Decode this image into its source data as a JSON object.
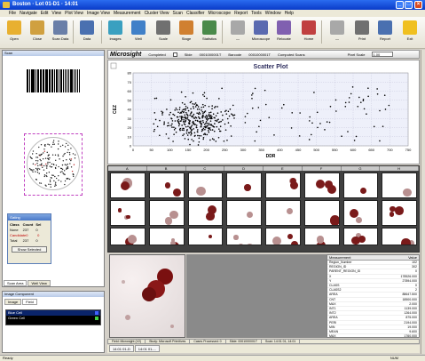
{
  "window": {
    "title": "Boston · Lot 01-D1 · 14:01"
  },
  "menu": [
    "File",
    "Navigate",
    "Edit",
    "View",
    "Plot View",
    "Image View",
    "Measurement",
    "Cluster View",
    "Scan",
    "Classifier",
    "Microscope",
    "Report",
    "Tools",
    "Window",
    "Help"
  ],
  "toolbar": [
    {
      "label": "Open",
      "icon": "folder-open-icon",
      "color": "#e8b030"
    },
    {
      "label": "Close",
      "icon": "folder-close-icon",
      "color": "#d0a040"
    },
    {
      "label": "Scan Data",
      "icon": "scan-data-icon",
      "color": "#6a7fa8"
    },
    {
      "label": "Data",
      "icon": "data-table-icon",
      "color": "#4a70b0"
    },
    {
      "label": "Images",
      "icon": "images-icon",
      "color": "#3aa0c0"
    },
    {
      "label": "Well",
      "icon": "well-icon",
      "color": "#4080c8"
    },
    {
      "label": "Scale",
      "icon": "scale-icon",
      "color": "#707070"
    },
    {
      "label": "Stage",
      "icon": "stage-icon",
      "color": "#d08030"
    },
    {
      "label": "Statistics",
      "icon": "statistics-icon",
      "color": "#4a8a4a"
    },
    {
      "label": "—",
      "icon": "disabled-icon",
      "color": "#a8a8a8"
    },
    {
      "label": "Microscope",
      "icon": "microscope-icon",
      "color": "#5a6ab0"
    },
    {
      "label": "Relocate",
      "icon": "relocate-icon",
      "color": "#8060b0"
    },
    {
      "label": "Home",
      "icon": "home-icon",
      "color": "#c04040"
    },
    {
      "label": "—",
      "icon": "disabled-icon-2",
      "color": "#a8a8a8"
    },
    {
      "label": "Print",
      "icon": "print-icon",
      "color": "#707070"
    },
    {
      "label": "Report",
      "icon": "report-icon",
      "color": "#4a70b0"
    },
    {
      "label": "Exit",
      "icon": "exit-icon",
      "color": "#f0c020"
    }
  ],
  "left_panel": {
    "head": "Scan",
    "tabs": [
      "Scan Area",
      "Well View"
    ],
    "dialog": {
      "caption": "Gating",
      "headers": [
        "Class",
        "Count",
        "Sel"
      ],
      "rows": [
        [
          "None",
          "237",
          "0"
        ],
        [
          "Candidate",
          "0",
          "0"
        ],
        [
          "Total",
          "237",
          "0"
        ]
      ],
      "button": "Show Selected"
    }
  },
  "legend_panel": {
    "head": "Image Component",
    "tabs": [
      "Image",
      "Field"
    ],
    "items": [
      {
        "label": "Blue Cell",
        "color": "#4060ff"
      },
      {
        "label": "Green Cell",
        "color": "#40d040"
      }
    ]
  },
  "main": {
    "title": "Microsight",
    "completed_label": "Completed",
    "slide_label": "Slide",
    "slide_value": "0001000001T",
    "barcode_label": "Barcode",
    "barcode_value": "0001000001T",
    "computed_label": "Computed Scans",
    "pixel_label": "Pixel Scale",
    "pixel_value": "1.00"
  },
  "chart_data": {
    "type": "scatter",
    "title": "Scatter Plot",
    "xlabel": "DDR",
    "ylabel": "CEZ",
    "xlim": [
      0,
      750
    ],
    "ylim": [
      0,
      80
    ],
    "x_ticks": [
      0,
      50,
      100,
      150,
      200,
      250,
      300,
      350,
      400,
      450,
      500,
      550,
      600,
      650,
      700,
      750
    ],
    "y_ticks": [
      0,
      10,
      20,
      30,
      40,
      50,
      60,
      70,
      80
    ],
    "grid": true,
    "series": [
      {
        "name": "",
        "color": "#000000"
      }
    ]
  },
  "cell_grid": {
    "columns": [
      "A",
      "B",
      "C",
      "D",
      "E",
      "F",
      "G",
      "H"
    ],
    "rows": 3
  },
  "properties": {
    "headers": [
      "Measurement",
      "Value"
    ],
    "rows": [
      [
        "Region_Number",
        "102"
      ],
      [
        "REGION_ID",
        "302"
      ],
      [
        "PARENT_REGION_ID",
        "0"
      ],
      [
        "X",
        "178526.000"
      ],
      [
        "Y",
        "27894.000"
      ],
      [
        "CLASS",
        "0"
      ],
      [
        "CLASS2",
        "2"
      ],
      [
        "AREA",
        "88647.500"
      ],
      [
        "CNT",
        "18500.000"
      ],
      [
        "MAX",
        "2.000"
      ],
      [
        "INT1",
        "1139.000"
      ],
      [
        "INT2",
        "1264.000"
      ],
      [
        "AREA",
        "875.000"
      ],
      [
        "PERI",
        "2194.000"
      ],
      [
        "MIN",
        "19.000"
      ],
      [
        "MEAN",
        "9.600"
      ],
      [
        "MAX",
        "1760.000"
      ]
    ]
  },
  "info_bar": [
    "Field: Microsight (V2)",
    "Study: Microsoft Primitives",
    "Cases Processed: 0",
    "Slide: 0001000001T",
    "Scan: 14:01 01, 14:01"
  ],
  "doc_tabs": [
    "14:01 01-D",
    "14:01 01-..."
  ],
  "status": "Ready",
  "status_right": "NUM"
}
